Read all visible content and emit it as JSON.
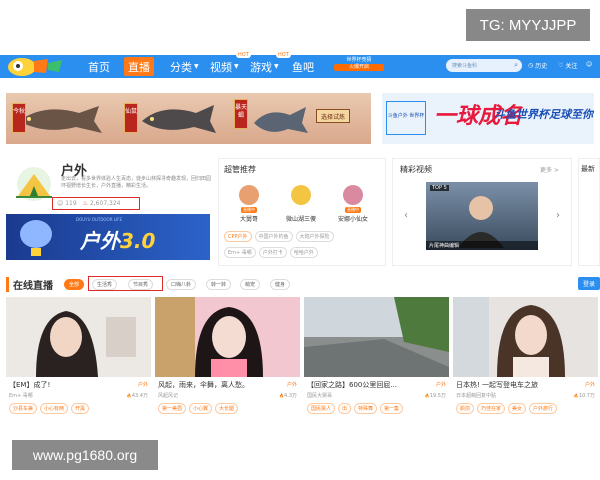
{
  "watermarks": {
    "telegram": "TG: MYYJJPP",
    "website": "www.pg1680.org"
  },
  "nav": {
    "items": [
      "首页",
      "直播",
      "分类",
      "视频",
      "游戏",
      "鱼吧"
    ],
    "hot_badge": "HOT",
    "promo_line1": "世界杯竞猜",
    "promo_line2": "火爆开启",
    "search_placeholder": "搜索斗鱼科",
    "right_items": [
      "历史",
      "关注"
    ]
  },
  "banner_left": {
    "tags": [
      "今秋",
      "仙鼠",
      "暴天蝎"
    ],
    "button": "选择试炼"
  },
  "banner_right": {
    "small_logo": "斗鱼户外 世界杯",
    "title": "一球成名",
    "subtitle": "斗鱼世界杯足球至你"
  },
  "category": {
    "title": "户外",
    "description": "走出去，看多世界体验人生百态，徒步山林探寻奇趣发现，回归田园环视野增长生长，户外直播，精彩生活。",
    "stats": {
      "followers": "119",
      "heat": "2,607,324"
    },
    "banner": {
      "small": "DOUYU OUTDOOR LIFE",
      "title_a": "户外",
      "title_b": "3.0"
    }
  },
  "super_recommend": {
    "title": "超管推荐",
    "live_badge": "直播中",
    "anchors": [
      {
        "name": "大舅哥",
        "color": "#e8a070"
      },
      {
        "name": "微山湖三傻",
        "color": "#f4c542"
      },
      {
        "name": "安娜小仙女",
        "color": "#d98aa0"
      }
    ],
    "tags_row1": [
      "CPP户外",
      "中国户外钓鱼",
      "大炮户外探险"
    ],
    "tags_row2": [
      "Em+ 毒哪",
      "户外打卡",
      "哈哈户外"
    ]
  },
  "videos": {
    "title": "精彩视频",
    "more": "更多 >",
    "top_label": "TOP 5",
    "caption": "片尾神曲编辑",
    "latest_title": "最新"
  },
  "live": {
    "title": "在线直播",
    "filters": [
      "全部",
      "生活秀",
      "节目秀",
      "口嗨八卦",
      "转一转",
      "萌宠",
      "健身"
    ],
    "login": "登录"
  },
  "rooms": [
    {
      "title": "【EM】成了!",
      "category": "户外",
      "anchor": "Em+ 毒哪",
      "heat": "43.4万",
      "tags": [
        "沙县车兼",
        "小心有两",
        "开黑"
      ]
    },
    {
      "title": "风起，雨来，伞舞，离人愁。",
      "category": "户外",
      "anchor": "风起风记",
      "heat": "4.3万",
      "tags": [
        "第一美眉",
        "小心翼",
        "大长腿"
      ]
    },
    {
      "title": "【回家之路】600公里回屁...",
      "category": "户外",
      "anchor": "国民大舅哥",
      "heat": "19.5万",
      "tags": [
        "国民舅人",
        "出",
        "特殊舞",
        "第一集"
      ]
    },
    {
      "title": "日本热! 一起写登电车之旅",
      "category": "户外",
      "anchor": "日本超萌回复中贴",
      "heat": "10.7万",
      "tags": [
        "颜前",
        "巧佳在家",
        "美女",
        "户外旅行"
      ]
    }
  ]
}
